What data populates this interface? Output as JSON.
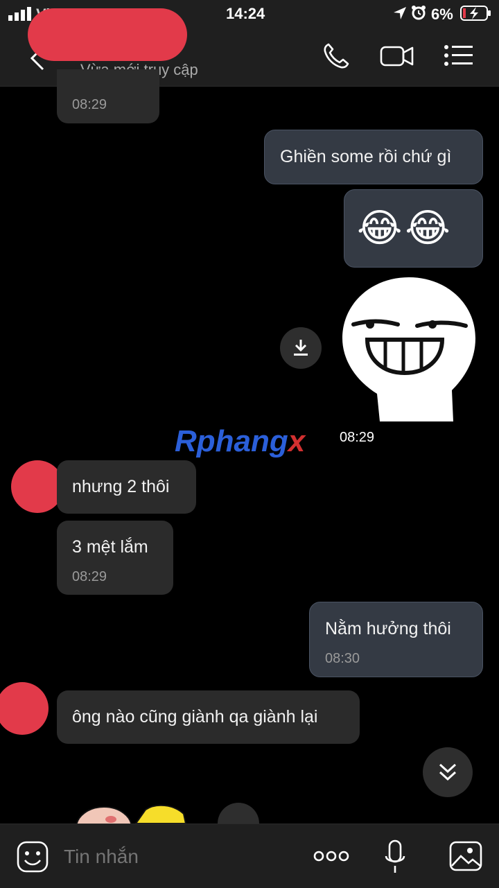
{
  "status_bar": {
    "carrier": "Vi...",
    "time": "14:24",
    "battery": "6%"
  },
  "header": {
    "subtitle": "Vừa mới truy cập",
    "icons": [
      "back-icon",
      "phone-icon",
      "video-icon",
      "menu-list-icon"
    ]
  },
  "messages": [
    {
      "side": "in",
      "text": "",
      "time": "08:29"
    },
    {
      "side": "out",
      "text": "Ghiền some rồi chứ gì",
      "time": ""
    },
    {
      "side": "out",
      "text": "😂😂",
      "time": ""
    },
    {
      "side": "out",
      "type": "sticker",
      "text": "",
      "time": "08:29"
    },
    {
      "side": "in",
      "text": "nhưng 2 thôi",
      "time": ""
    },
    {
      "side": "in",
      "text": "3 mệt lắm",
      "time": "08:29"
    },
    {
      "side": "out",
      "text": "Nằm hưởng thôi",
      "time": "08:30"
    },
    {
      "side": "in",
      "text": "ông nào cũng giành qa giành lại",
      "time": ""
    }
  ],
  "watermark": {
    "part1": "Rphang",
    "part2": "x"
  },
  "input": {
    "placeholder": "Tin nhắn"
  },
  "colors": {
    "accent_red": "#e23a4a",
    "bubble_out": "#343a44",
    "bubble_in": "#2b2b2b"
  }
}
